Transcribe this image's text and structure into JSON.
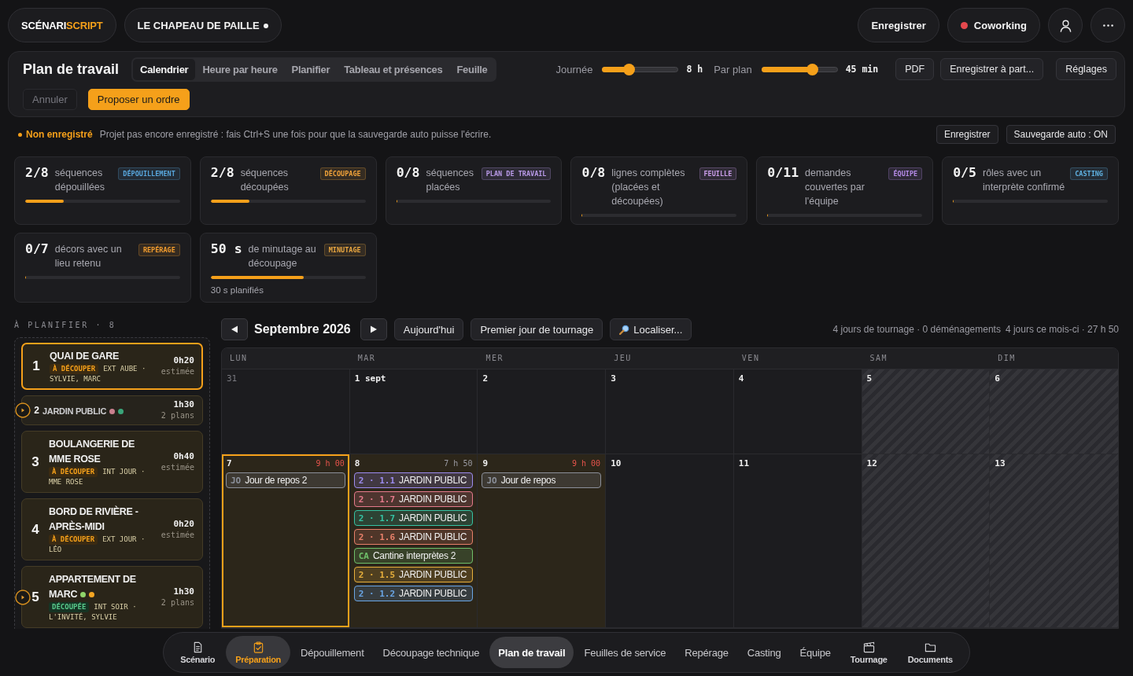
{
  "top_bar": {
    "logo": {
      "part_1": "SCÉNARI",
      "part_2": "SCRIPT"
    },
    "project": {
      "name": "LE CHAPEAU DE PAILLE",
      "unsaved": true
    },
    "save_button": "Enregistrer",
    "coworking": {
      "label": "Coworking",
      "online": false
    }
  },
  "toolbar": {
    "title": "Plan de travail",
    "tabs": [
      {
        "label": "Calendrier",
        "selected": true
      },
      {
        "label": "Heure par heure",
        "selected": false
      },
      {
        "label": "Planifier",
        "selected": false
      },
      {
        "label": "Tableau et présences",
        "selected": false
      },
      {
        "label": "Feuille",
        "selected": false
      }
    ],
    "sliders": [
      {
        "label": "Journée",
        "level": 0.35,
        "reading": "8 h"
      },
      {
        "label": "Par plan",
        "level": 0.67,
        "reading": "45 min"
      }
    ],
    "buttons": [
      "PDF",
      "Enregistrer à part...",
      "Réglages"
    ],
    "actions": [
      {
        "label": "Annuler",
        "kind": "secondary",
        "disabled": true
      },
      {
        "label": "Proposer un ordre",
        "kind": "primary",
        "disabled": false
      }
    ]
  },
  "save_status": {
    "label": "Non enregistré",
    "message": "Projet pas encore enregistré : fais Ctrl+S une fois pour que la sauvegarde auto puisse l'écrire.",
    "buttons": [
      "Enregistrer",
      "Sauvegarde auto : ON"
    ]
  },
  "stats": [
    {
      "value": "2/8",
      "label": "séquences dépouillées",
      "tag": {
        "label": "DÉPOUILLEMENT",
        "color": "#58a6dc"
      },
      "level": 0.25
    },
    {
      "value": "2/8",
      "label": "séquences découpées",
      "tag": {
        "label": "DÉCOUPAGE",
        "color": "#f0a23a"
      },
      "level": 0.25
    },
    {
      "value": "0/8",
      "label": "séquences placées",
      "tag": {
        "label": "PLAN DE TRAVAIL",
        "color": "#b99ae8"
      },
      "level": 0
    },
    {
      "value": "0/8",
      "label": "lignes complètes (placées et découpées)",
      "tag": {
        "label": "FEUILLE",
        "color": "#c99ce8"
      },
      "level": 0
    },
    {
      "value": "0/11",
      "label": "demandes couvertes par l'équipe",
      "tag": {
        "label": "ÉQUIPE",
        "color": "#b48ae6"
      },
      "level": 0
    },
    {
      "value": "0/5",
      "label": "rôles avec un interprète confirmé",
      "tag": {
        "label": "CASTING",
        "color": "#5fb0e0"
      },
      "level": 0
    },
    {
      "value": "0/7",
      "label": "décors avec un lieu retenu",
      "tag": {
        "label": "REPÉRAGE",
        "color": "#f29c2e"
      },
      "level": 0
    },
    {
      "value": "50 s",
      "label": "de minutage au découpage",
      "tag": {
        "label": "MINUTAGE",
        "color": "#e8a640"
      },
      "level": 0.6,
      "note": "30 s planifiés"
    }
  ],
  "planning_list": {
    "title": "À PLANIFIER · 8",
    "scenes": [
      {
        "number": "1",
        "title": "QUAI DE GARE",
        "kind": "scene",
        "selected": true,
        "status": {
          "label": "À DÉCOUPER",
          "kind": "todo"
        },
        "setting": "EXT AUBE ·",
        "cast": "SYLVIE, MARC",
        "duration": "0h20",
        "duration_note": "estimée"
      },
      {
        "number": "2",
        "title": "JARDIN PUBLIC",
        "kind": "compact",
        "selected": false,
        "dots": [
          {
            "color": "#c9808f"
          },
          {
            "color": "#3aa57a"
          }
        ],
        "duration": "1h30",
        "duration_note": "2 plans"
      },
      {
        "number": "3",
        "title": "BOULANGERIE DE MME ROSE",
        "kind": "scene",
        "selected": false,
        "status": {
          "label": "À DÉCOUPER",
          "kind": "todo"
        },
        "setting": "INT JOUR ·",
        "cast": "MME ROSE",
        "duration": "0h40",
        "duration_note": "estimée"
      },
      {
        "number": "4",
        "title": "BORD DE RIVIÈRE - APRÈS-MIDI",
        "kind": "scene",
        "selected": false,
        "status": {
          "label": "À DÉCOUPER",
          "kind": "todo"
        },
        "setting": "EXT JOUR ·",
        "cast": "LÉO",
        "duration": "0h20",
        "duration_note": "estimée"
      },
      {
        "number": "5",
        "title": "APPARTEMENT DE MARC",
        "kind": "grouped",
        "selected": false,
        "dots": [
          {
            "color": "#8fd46a"
          },
          {
            "color": "#f5a623"
          }
        ],
        "status": {
          "label": "DÉCOUPÉE",
          "kind": "done"
        },
        "setting": "INT SOIR ·",
        "cast": "L'INVITÉ, SYLVIE",
        "duration": "1h30",
        "duration_note": "2 plans"
      }
    ]
  },
  "calendar": {
    "month": "Septembre 2026",
    "buttons": [
      {
        "label": "Aujourd'hui",
        "kind": "plain"
      },
      {
        "label": "Premier jour de tournage",
        "kind": "plain"
      },
      {
        "label": "Localiser...",
        "kind": "search"
      }
    ],
    "summary": [
      "4 jours de tournage · 0 déménagements",
      "4 jours ce mois-ci · 27 h 50"
    ],
    "weekdays": [
      "LUN",
      "MAR",
      "MER",
      "JEU",
      "VEN",
      "SAM",
      "DIM"
    ],
    "weeks": [
      {
        "days": [
          {
            "date": "31",
            "in_month": false,
            "weekend": false,
            "shooting": false,
            "selected": false
          },
          {
            "date": "1 sept",
            "in_month": true,
            "weekend": false,
            "shooting": false,
            "selected": false
          },
          {
            "date": "2",
            "in_month": true,
            "weekend": false,
            "shooting": false,
            "selected": false
          },
          {
            "date": "3",
            "in_month": true,
            "weekend": false,
            "shooting": false,
            "selected": false
          },
          {
            "date": "4",
            "in_month": true,
            "weekend": false,
            "shooting": false,
            "selected": false
          },
          {
            "date": "5",
            "in_month": true,
            "weekend": true,
            "shooting": false,
            "selected": false
          },
          {
            "date": "6",
            "in_month": true,
            "weekend": true,
            "shooting": false,
            "selected": false
          }
        ]
      },
      {
        "days": [
          {
            "date": "7",
            "in_month": true,
            "weekend": false,
            "shooting": true,
            "selected": true,
            "hours": "9 h 00",
            "over": true,
            "events": [
              {
                "prefix": "JO",
                "label": "Jour de repos 2",
                "color": "#8b909a"
              }
            ]
          },
          {
            "date": "8",
            "in_month": true,
            "weekend": false,
            "shooting": true,
            "selected": false,
            "hours": "7 h 50",
            "over": false,
            "events": [
              {
                "prefix": "2 · 1.1",
                "label": "JARDIN PUBLIC",
                "color": "#9d8cf0"
              },
              {
                "prefix": "2 · 1.7",
                "label": "JARDIN PUBLIC",
                "color": "#e67a8c"
              },
              {
                "prefix": "2 · 1.7",
                "label": "JARDIN PUBLIC",
                "color": "#35c4a4"
              },
              {
                "prefix": "2 · 1.6",
                "label": "JARDIN PUBLIC",
                "color": "#e8806a"
              },
              {
                "prefix": "CA",
                "label": "Cantine interprètes 2",
                "color": "#6fbf6a"
              },
              {
                "prefix": "2 · 1.5",
                "label": "JARDIN PUBLIC",
                "color": "#e8b03c"
              },
              {
                "prefix": "2 · 1.2",
                "label": "JARDIN PUBLIC",
                "color": "#6aa6e6"
              }
            ]
          },
          {
            "date": "9",
            "in_month": true,
            "weekend": false,
            "shooting": true,
            "selected": false,
            "hours": "9 h 00",
            "over": true,
            "events": [
              {
                "prefix": "JO",
                "label": "Jour de repos",
                "color": "#8b909a"
              }
            ]
          },
          {
            "date": "10",
            "in_month": true,
            "weekend": false,
            "shooting": false,
            "selected": false
          },
          {
            "date": "11",
            "in_month": true,
            "weekend": false,
            "shooting": false,
            "selected": false
          },
          {
            "date": "12",
            "in_month": true,
            "weekend": true,
            "shooting": false,
            "selected": false
          },
          {
            "date": "13",
            "in_month": true,
            "weekend": true,
            "shooting": false,
            "selected": false
          }
        ]
      }
    ]
  },
  "bottom_nav": {
    "items": [
      {
        "label": "Scénario",
        "expanded": false
      },
      {
        "label": "Préparation",
        "expanded": true,
        "children": [
          {
            "label": "Dépouillement",
            "selected": false
          },
          {
            "label": "Découpage technique",
            "selected": false
          },
          {
            "label": "Plan de travail",
            "selected": true
          },
          {
            "label": "Feuilles de service",
            "selected": false
          },
          {
            "label": "Repérage",
            "selected": false
          },
          {
            "label": "Casting",
            "selected": false
          },
          {
            "label": "Équipe",
            "selected": false
          }
        ]
      },
      {
        "label": "Tournage",
        "expanded": false
      },
      {
        "label": "Documents",
        "expanded": false
      }
    ]
  }
}
